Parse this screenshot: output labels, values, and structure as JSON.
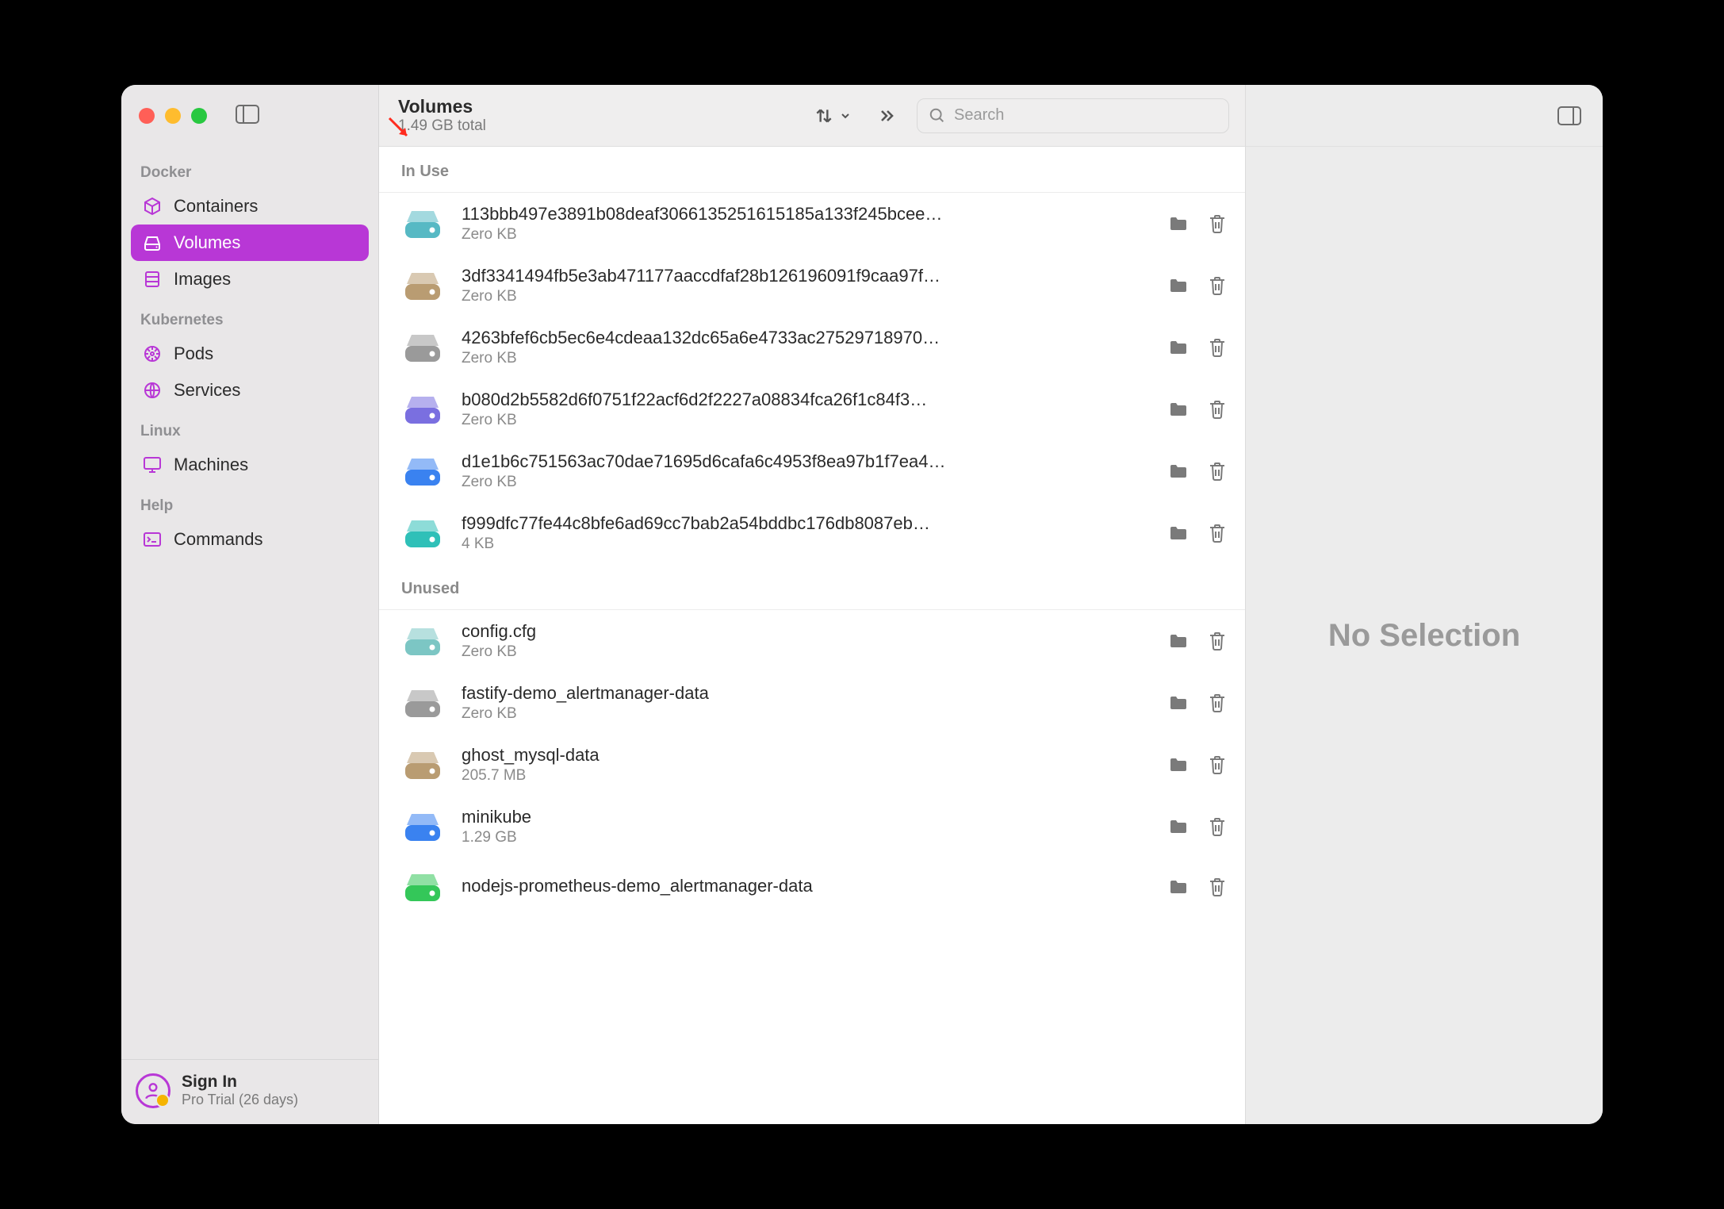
{
  "header": {
    "title": "Volumes",
    "subtitle": "1.49 GB total",
    "search_placeholder": "Search"
  },
  "sidebar": {
    "sections": [
      {
        "label": "Docker",
        "items": [
          {
            "label": "Containers"
          },
          {
            "label": "Volumes"
          },
          {
            "label": "Images"
          }
        ]
      },
      {
        "label": "Kubernetes",
        "items": [
          {
            "label": "Pods"
          },
          {
            "label": "Services"
          }
        ]
      },
      {
        "label": "Linux",
        "items": [
          {
            "label": "Machines"
          }
        ]
      },
      {
        "label": "Help",
        "items": [
          {
            "label": "Commands"
          }
        ]
      }
    ],
    "footer": {
      "title": "Sign In",
      "subtitle": "Pro Trial (26 days)"
    }
  },
  "list": {
    "groups": [
      {
        "label": "In Use",
        "items": [
          {
            "name": "113bbb497e3891b08deaf3066135251615185a133f245bcee…",
            "size": "Zero KB",
            "color": "#57b9c4"
          },
          {
            "name": "3df3341494fb5e3ab471177aaccdfaf28b126196091f9caa97f…",
            "size": "Zero KB",
            "color": "#b99c72"
          },
          {
            "name": "4263bfef6cb5ec6e4cdeaa132dc65a6e4733ac27529718970…",
            "size": "Zero KB",
            "color": "#9a9a9a"
          },
          {
            "name": "b080d2b5582d6f0751f22acf6d2f2227a08834fca26f1c84f3…",
            "size": "Zero KB",
            "color": "#7a6fe0"
          },
          {
            "name": "d1e1b6c751563ac70dae71695d6cafa6c4953f8ea97b1f7ea4…",
            "size": "Zero KB",
            "color": "#3a82f0"
          },
          {
            "name": "f999dfc77fe44c8bfe6ad69cc7bab2a54bddbc176db8087eb…",
            "size": "4 KB",
            "color": "#2fc0b8"
          }
        ]
      },
      {
        "label": "Unused",
        "items": [
          {
            "name": "config.cfg",
            "size": "Zero KB",
            "color": "#7cc6c4"
          },
          {
            "name": "fastify-demo_alertmanager-data",
            "size": "Zero KB",
            "color": "#9a9a9a"
          },
          {
            "name": "ghost_mysql-data",
            "size": "205.7 MB",
            "color": "#b99c72"
          },
          {
            "name": "minikube",
            "size": "1.29 GB",
            "color": "#3a82f0"
          },
          {
            "name": "nodejs-prometheus-demo_alertmanager-data",
            "size": "",
            "color": "#34c759"
          }
        ]
      }
    ]
  },
  "right": {
    "placeholder": "No Selection"
  }
}
